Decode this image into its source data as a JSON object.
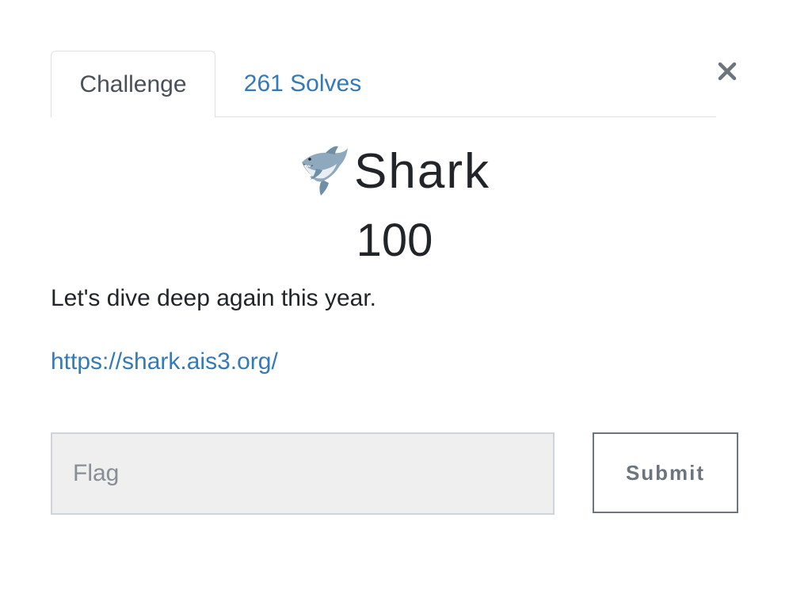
{
  "modal": {
    "close_icon": "close-icon"
  },
  "tabs": [
    {
      "label": "Challenge",
      "active": true
    },
    {
      "label": "261 Solves",
      "active": false
    }
  ],
  "challenge": {
    "icon": "shark-icon",
    "name": "Shark",
    "value": "100",
    "description": "Let's dive deep again this year.",
    "link": "https://shark.ais3.org/"
  },
  "form": {
    "flag_placeholder": "Flag",
    "flag_value": "",
    "submit_label": "Submit"
  },
  "colors": {
    "link": "#337ab7",
    "text": "#212529",
    "input_bg": "#efefef",
    "button_border": "#6c757d"
  }
}
